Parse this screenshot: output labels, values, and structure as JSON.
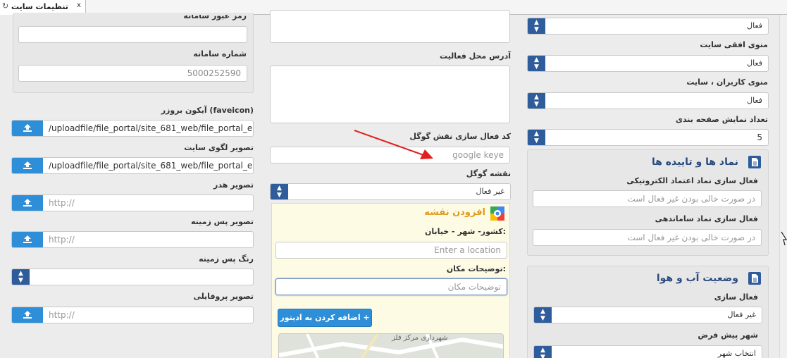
{
  "tab": {
    "icon": "refresh-icon",
    "title": "تنظیمات سایت",
    "close": "x"
  },
  "left": {
    "sms_password_label": "رمز عبور سامانه",
    "sms_password_value": "",
    "sms_number_label": "شماره سامانه",
    "sms_number_value": "5000252590",
    "favicon_label": "آیکون بروزر (faveicon)",
    "favicon_value": "/uploadfile/file_portal/site_681_web/file_portal_er",
    "logo_label": "تصویر لگوی سایت",
    "logo_value": "/uploadfile/file_portal/site_681_web/file_portal_er",
    "header_label": "تصویر هدر",
    "header_placeholder": "http://",
    "background_label": "تصویر پس زمینه",
    "background_placeholder": "http://",
    "bgcolor_label": "رنگ پس زمینه",
    "profile_label": "تصویر پروفایلی",
    "profile_placeholder": "http://"
  },
  "middle": {
    "address_label": "آدرس محل فعالیت",
    "google_key_label": "کد فعال سازی نقش گوگل",
    "google_key_placeholder": "google keye",
    "google_map_label": "نقشه گوگل",
    "google_map_value": "غیر فعال",
    "add_map": {
      "title": "افزودن نقشه",
      "location_label": "کشور- شهر - خیابان:",
      "location_placeholder": "Enter a location",
      "place_desc_label": "توضیحات مکان:",
      "place_desc_placeholder": "توضیحات مکان",
      "add_button": "+ اضافه کردن به ادیتور",
      "map_text": "شهرداری مرکز فلز"
    }
  },
  "right": {
    "select1_value": "فعال",
    "horizontal_menu_label": "منوی افقی سایت",
    "horizontal_menu_value": "فعال",
    "users_menu_label": "منوی کاربران ، سایت",
    "users_menu_value": "فعال",
    "pagination_label": "تعداد نمایش صفحه بندی",
    "pagination_value": "5",
    "symbols_panel": {
      "title": "نماد ها و تاییده ها",
      "enamad_label": "فعال سازی نماد اعتماد الکترونیکی",
      "enamad_placeholder": "در صورت خالی بودن غیر فعال است",
      "samandehi_label": "فعال سازی نماد ساماندهی",
      "samandehi_placeholder": "در صورت خالی بودن غیر فعال است"
    },
    "weather_panel": {
      "title": "وضعیت آب و هوا",
      "activate_label": "فعال سازی",
      "activate_value": "غیر فعال",
      "default_city_label": "شهر پیش فرض",
      "default_city_value": "انتخاب شهر"
    }
  },
  "colors": {
    "select_button": "#2f5d9b",
    "upload_button": "#2e8fd8",
    "panel_title": "#2a4b7d",
    "map_title": "#e09a1c",
    "arrow": "#e02020"
  }
}
